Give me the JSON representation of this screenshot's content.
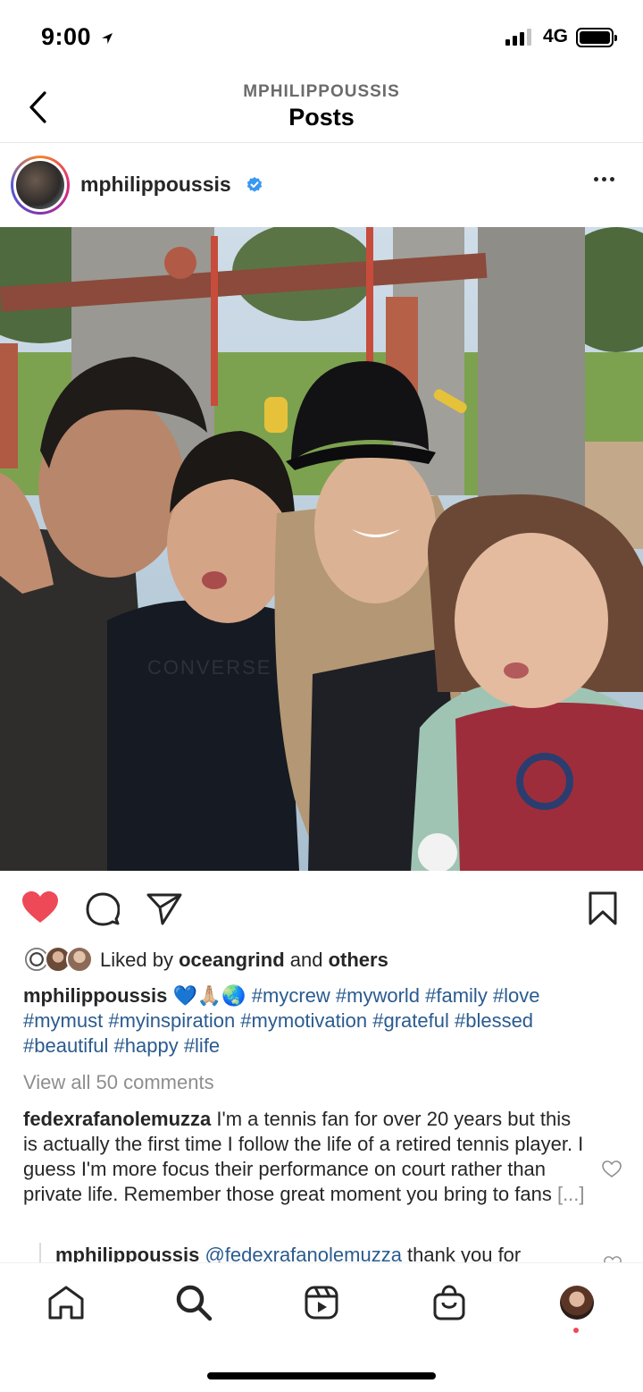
{
  "status_bar": {
    "time": "9:00",
    "network": "4G"
  },
  "header": {
    "subtitle": "MPHILIPPOUSSIS",
    "title": "Posts"
  },
  "post": {
    "username": "mphilippoussis",
    "verified": true,
    "likes": {
      "prefix": "Liked by ",
      "user": "oceangrind",
      "middle": " and ",
      "others": "others"
    },
    "caption": {
      "user": "mphilippoussis",
      "emoji": " 💙🙏🏼🌏 ",
      "hashtags": "#mycrew #myworld #family #love #mymust #myinspiration #mymotivation #grateful #blessed #beautiful #happy #life"
    },
    "view_comments": "View all 50 comments",
    "comment": {
      "user": "fedexrafanolemuzza",
      "text": " I'm a tennis fan for over 20 years but this is actually the first time I follow the life of a retired tennis player. I guess I'm more focus their performance on court rather than private life. Remember those great moment you bring to fans ",
      "more": "[...]"
    },
    "reply": {
      "user": "mphilippoussis",
      "mention": " @fedexrafanolemuzza",
      "text": " thank you for"
    }
  },
  "nav": {
    "items": [
      "home-icon",
      "search-icon",
      "reels-icon",
      "shop-icon",
      "profile-avatar"
    ],
    "active": "search-icon"
  },
  "colors": {
    "like": "#ed4956",
    "verified": "#3897f0",
    "hashtag": "#2a5b8f",
    "muted": "#8e8e8e"
  }
}
